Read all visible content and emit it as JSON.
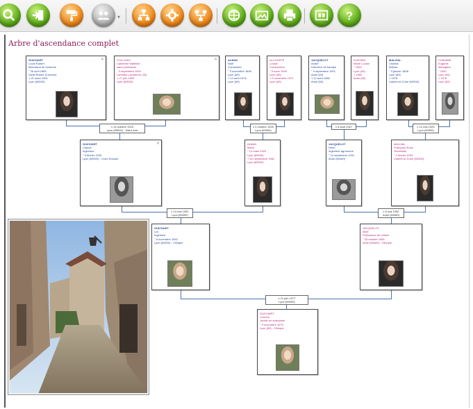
{
  "app": {
    "toolbar": [
      {
        "name": "search-button",
        "icon": "magnifier-icon",
        "color": "green"
      },
      {
        "name": "enter-button",
        "icon": "enter-arrow-icon",
        "color": "green"
      },
      {
        "name": "paint-button",
        "icon": "paint-roller-icon",
        "color": "orange"
      },
      {
        "name": "group-button",
        "icon": "people-icon",
        "color": "gray"
      },
      {
        "name": "tree-up-button",
        "icon": "tree-up-icon",
        "color": "orange"
      },
      {
        "name": "tree-center-button",
        "icon": "tree-center-icon",
        "color": "orange"
      },
      {
        "name": "tree-down-button",
        "icon": "tree-down-icon",
        "color": "orange"
      },
      {
        "name": "grid-button",
        "icon": "grid-icon",
        "color": "green"
      },
      {
        "name": "preview-button",
        "icon": "image-preview-icon",
        "color": "green"
      },
      {
        "name": "print-button",
        "icon": "printer-icon",
        "color": "green"
      },
      {
        "name": "export-button",
        "icon": "export-icon",
        "color": "green"
      },
      {
        "name": "help-button",
        "icon": "help-icon",
        "color": "green"
      }
    ],
    "colors": {
      "title": "#8a1a5a",
      "male": "#2a4a9a",
      "female": "#b8307a",
      "connector": "#4a72b0"
    }
  },
  "chart": {
    "title": "Arbre d'ascendance complet",
    "gen3": [
      {
        "id": "g3-1",
        "lines": [
          "GUICHART",
          "Louis Robert",
          "Marchand de bonbons",
          "° 26 avril 1895",
          "Saint-Robert (Corrèze)",
          "† 20 mars 1951",
          "Lyon (69000)"
        ]
      },
      {
        "id": "g3-2",
        "lines": [
          "COLLIGNY",
          "Catherine Mathilde",
          "sans profession",
          "° 3 septembre 1904",
          "Lamothe-Landerron (33)",
          "† 27 juin 1993",
          "Lyon (69000)"
        ]
      },
      {
        "id": "g3-3",
        "lines": [
          "ALBAN",
          "Noël",
          "Cordonnier",
          "° 3 novembre 1896",
          "Lyon (69)",
          "† 13 août 1976",
          "Lyon (69)"
        ]
      },
      {
        "id": "g3-4",
        "lines": [
          "ALCOUFFE",
          "Louise",
          "Cordonnière",
          "° 5 mars 1905",
          "Lyon (69)",
          "† 3 novembre 1972",
          "Lyon (69)"
        ]
      },
      {
        "id": "g3-5",
        "lines": [
          "JACQUELOT",
          "André",
          "Directeur de banque",
          "° 9 septembre 1901",
          "Anse (69)",
          "† 12 août 1986",
          "Anse (69)"
        ]
      },
      {
        "id": "g3-6",
        "lines": [
          "DUPOND",
          "Marie Louise",
          "° 1903",
          "Lyon (69)",
          "† 1982",
          "Anse (69)"
        ]
      },
      {
        "id": "g3-7",
        "lines": [
          "MALIVAL",
          "Charles",
          "Artisan",
          "° 3 janvier 1898",
          "Lyon (69)",
          "† 1978",
          "Caluire-et-Cuire (69300)"
        ]
      },
      {
        "id": "g3-8",
        "lines": [
          "CHAVANE",
          "Eugénie",
          "Ménagère",
          "° 1900",
          "Lyon (69)",
          "† 1976",
          "Lyon (69)"
        ]
      }
    ],
    "gen2": [
      {
        "id": "g2-1",
        "lines": [
          "GUICHART",
          "Claude",
          "Ingénieur",
          "° 5 février 1925",
          "Lyon (69000) - Croix-Rousse"
        ]
      },
      {
        "id": "g2-2",
        "lines": [
          "ALBAN",
          "Marie",
          "° 12 mars 1929",
          "Lyon (69000)",
          "† 1er septembre 1981",
          "Lyon (69000)"
        ]
      },
      {
        "id": "g2-3",
        "lines": [
          "JACQUELOT",
          "Henri",
          "Ingénieur agronome",
          "° 12 septembre 1931",
          "Anse (69480)"
        ]
      },
      {
        "id": "g2-4",
        "lines": [
          "MALIVAL",
          "Françoise Rose",
          "Secrétaire",
          "° 1 février 1934",
          "Caluire-et-Cuire (69300)"
        ]
      }
    ],
    "gen1": [
      {
        "id": "g1-1",
        "lines": [
          "GUICHART",
          "Luc",
          "Ingénieur",
          "° 8 novembre 1952",
          "Lyon (69000) - Clinique"
        ]
      },
      {
        "id": "g1-2",
        "lines": [
          "JACQUELOT",
          "Alice",
          "Professeur de Lettres",
          "° 18 octobre 1955",
          "Anse (69480) - Clinique"
        ]
      }
    ],
    "gen0": {
      "id": "g0-1",
      "lines": [
        "GUICHART",
        "Corinne",
        "Juriste en entreprise",
        "° 3 novembre 1979",
        "Lyon (69) - Clinique"
      ]
    },
    "unions": [
      {
        "id": "u1",
        "lines": [
          "x 14 octobre 1923",
          "Lyon (69000) - Saint-Just"
        ]
      },
      {
        "id": "u2",
        "lines": [
          "x 4 octobre 1925",
          "Lyon (69000)"
        ]
      },
      {
        "id": "u3",
        "lines": [
          "x 5 août 1927"
        ]
      },
      {
        "id": "u4",
        "lines": [
          "x 12 mai 1929",
          "Lyon (69000)"
        ]
      },
      {
        "id": "u5",
        "lines": [
          "x 14 mai 1951",
          "Lyon (69000)"
        ]
      },
      {
        "id": "u6",
        "lines": [
          "x 5 mai 1952",
          "Anse (69480)"
        ]
      },
      {
        "id": "u7",
        "lines": [
          "x 21 juin 1977",
          "Lyon (69000)"
        ]
      }
    ]
  }
}
